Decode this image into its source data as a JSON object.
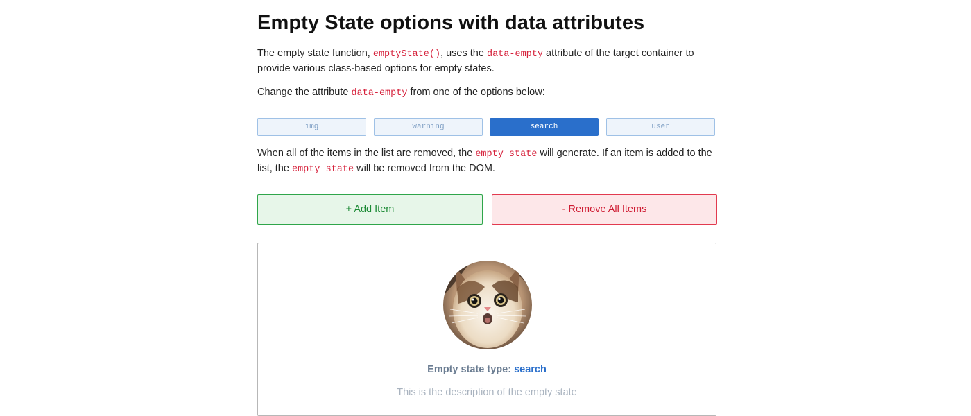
{
  "page": {
    "title": "Empty State options with data attributes"
  },
  "intro": {
    "t1": "The empty state function, ",
    "code1": "emptyState()",
    "t2": ", uses the ",
    "code2": "data-empty",
    "t3": " attribute of the target container to provide various class-based options for empty states."
  },
  "change": {
    "t1": "Change the attribute ",
    "code1": "data-empty",
    "t2": " from one of the options below:"
  },
  "options": [
    {
      "label": "img",
      "active": false
    },
    {
      "label": "warning",
      "active": false
    },
    {
      "label": "search",
      "active": true
    },
    {
      "label": "user",
      "active": false
    }
  ],
  "explain": {
    "t1": "When all of the items in the list are removed, the ",
    "code1": "empty state",
    "t2": " will generate. If an item is added to the list, the ",
    "code2": "empty state",
    "t3": " will be removed from the DOM."
  },
  "actions": {
    "add_label": "+ Add Item",
    "remove_label": "- Remove All Items"
  },
  "empty_state": {
    "type_prefix": "Empty state type: ",
    "type_value": "search",
    "description": "This is the description of the empty state",
    "image_icon": "surprised-cat-photo"
  },
  "colors": {
    "accent": "#2a6fcb",
    "code": "#d6213b",
    "add": "#1c8a35",
    "remove": "#cf1c33"
  }
}
